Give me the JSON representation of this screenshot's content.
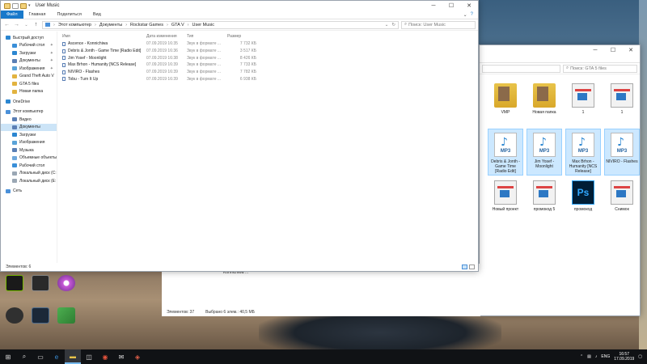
{
  "front_window": {
    "title": "User Music",
    "ribbon_tabs": [
      "Файл",
      "Главная",
      "Поделиться",
      "Вид"
    ],
    "breadcrumb": [
      "Этот компьютер",
      "Документы",
      "Rockstar Games",
      "GTA V",
      "User Music"
    ],
    "search_placeholder": "Поиск: User Music",
    "nav_items": [
      {
        "label": "Быстрый доступ",
        "color": "#2b86d1",
        "level": 0
      },
      {
        "label": "Рабочий стол",
        "color": "#3a8fd8",
        "level": 1,
        "pinned": true
      },
      {
        "label": "Загрузки",
        "color": "#2b86d1",
        "level": 1,
        "pinned": true
      },
      {
        "label": "Документы",
        "color": "#5a7fb5",
        "level": 1,
        "pinned": true
      },
      {
        "label": "Изображения",
        "color": "#5aa3d8",
        "level": 1,
        "pinned": true
      },
      {
        "label": "Grand Theft Auto V",
        "color": "#e2b33f",
        "level": 1,
        "pinned": true
      },
      {
        "label": "GTA 5 files",
        "color": "#e2b33f",
        "level": 1
      },
      {
        "label": "Новая папка",
        "color": "#e2b33f",
        "level": 1
      },
      {
        "label": "OneDrive",
        "color": "#2b86d1",
        "level": 0,
        "gap": true
      },
      {
        "label": "Этот компьютер",
        "color": "#4a90d9",
        "level": 0,
        "gap": true
      },
      {
        "label": "Видео",
        "color": "#5a7fb5",
        "level": 1
      },
      {
        "label": "Документы",
        "color": "#5a7fb5",
        "level": 1,
        "selected": true
      },
      {
        "label": "Загрузки",
        "color": "#2b86d1",
        "level": 1
      },
      {
        "label": "Изображения",
        "color": "#5aa3d8",
        "level": 1
      },
      {
        "label": "Музыка",
        "color": "#5a7fb5",
        "level": 1
      },
      {
        "label": "Объемные объекты",
        "color": "#6fa8dc",
        "level": 1
      },
      {
        "label": "Рабочий стол",
        "color": "#3a8fd8",
        "level": 1
      },
      {
        "label": "Локальный диск (C:",
        "color": "#9aa7b4",
        "level": 1
      },
      {
        "label": "Локальный диск (E:",
        "color": "#9aa7b4",
        "level": 1
      },
      {
        "label": "Сеть",
        "color": "#4a90d9",
        "level": 0,
        "gap": true
      }
    ],
    "columns": {
      "name": "Имя",
      "date": "Дата изменения",
      "type": "Тип",
      "size": "Размер"
    },
    "files": [
      {
        "name": "Ascence - Konnichiwa",
        "date": "07.09.2019 16:35",
        "type": "Звук в формате ...",
        "size": "7 732 КБ"
      },
      {
        "name": "Debris & Jonth - Game Time [Radio Edit]",
        "date": "07.09.2019 16:36",
        "type": "Звук в формате ...",
        "size": "3 517 КБ"
      },
      {
        "name": "Jim Yosef - Moonlight",
        "date": "07.09.2019 16:38",
        "type": "Звук в формате ...",
        "size": "8 426 КБ"
      },
      {
        "name": "Max Brhon - Humanity [NCS Release]",
        "date": "07.09.2019 16:39",
        "type": "Звук в формате ...",
        "size": "7 733 КБ"
      },
      {
        "name": "NIVIRO - Flashes",
        "date": "07.09.2019 16:39",
        "type": "Звук в формате ...",
        "size": "7 782 КБ"
      },
      {
        "name": "Tobu - Turn It Up",
        "date": "07.09.2019 16:39",
        "type": "Звук в формате ...",
        "size": "6 938 КБ"
      }
    ],
    "status": "Элементов: 6"
  },
  "back_window": {
    "search_placeholder": "Поиск: GTA 5 files",
    "tiles": [
      {
        "label": "VMP",
        "kind": "folder"
      },
      {
        "label": "Новая папка",
        "kind": "folder"
      },
      {
        "label": "1",
        "kind": "shot"
      },
      {
        "label": "1",
        "kind": "shot"
      },
      {
        "label": "Debris & Jonth - Game Time [Radio Edit]",
        "kind": "mp3",
        "selected": true
      },
      {
        "label": "Jim Yosef - Moonlight",
        "kind": "mp3",
        "selected": true
      },
      {
        "label": "Max Brhon - Humanity [NCS Release]",
        "kind": "mp3",
        "selected": true
      },
      {
        "label": "NIVIRO - Flashes",
        "kind": "mp3",
        "selected": true
      },
      {
        "label": "Новый проект",
        "kind": "shot"
      },
      {
        "label": "промокод 5",
        "kind": "shot"
      },
      {
        "label": "промокод",
        "kind": "ps"
      },
      {
        "label": "Снимок",
        "kind": "shot"
      }
    ],
    "mp3_badge": "MP3",
    "ps_badge": "Ps",
    "partial_text": "Konnichiwa ...",
    "status_count": "Элементов: 37",
    "status_selected": "Выбрано 6 элем.: 40,5 МБ"
  },
  "taskbar": {
    "lang": "ENG",
    "time": "16:57",
    "date": "17.09.2019"
  }
}
